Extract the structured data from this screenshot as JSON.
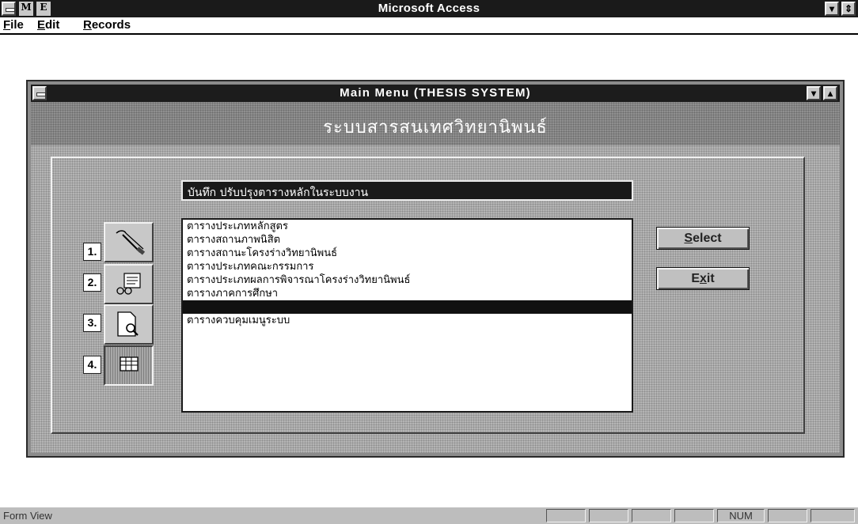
{
  "app": {
    "title": "Microsoft Access",
    "icon_m": "M",
    "icon_e": "E",
    "minimize_icon": "▾",
    "restore_icon": "⇕"
  },
  "menubar": {
    "items": [
      {
        "accel": "F",
        "rest": "ile"
      },
      {
        "accel": "E",
        "rest": "dit"
      },
      {
        "accel": "R",
        "rest": "ecords"
      }
    ]
  },
  "form": {
    "title": "Main  Menu  (THESIS  SYSTEM)",
    "minimize_icon": "▾",
    "maximize_icon": "▴",
    "heading": "ระบบสารสนเทศวิทยานิพนธ์",
    "caption": "บันทึก ปรับปรุงตารางหลักในระบบงาน",
    "list_items": [
      {
        "text": "ตารางประเภทหลักสูตร",
        "selected": false
      },
      {
        "text": "ตารางสถานภาพนิสิต",
        "selected": false
      },
      {
        "text": "ตารางสถานะโครงร่างวิทยานิพนธ์",
        "selected": false
      },
      {
        "text": "ตารางประเภทคณะกรรมการ",
        "selected": false
      },
      {
        "text": "ตารางประเภทผลการพิจารณาโครงร่างวิทยานิพนธ์",
        "selected": false
      },
      {
        "text": "ตารางภาคการศึกษา",
        "selected": false
      },
      {
        "text": "",
        "selected": true
      },
      {
        "text": "ตารางควบคุมเมนูระบบ",
        "selected": false
      }
    ],
    "nav_buttons": [
      {
        "number": "1.",
        "icon": "tools-icon",
        "pressed": false
      },
      {
        "number": "2.",
        "icon": "report-glasses-icon",
        "pressed": false
      },
      {
        "number": "3.",
        "icon": "document-magnifier-icon",
        "pressed": false
      },
      {
        "number": "4.",
        "icon": "table-grid-icon",
        "pressed": true
      }
    ],
    "select_button": {
      "accel": "S",
      "rest": "elect"
    },
    "exit_button": {
      "pre": "E",
      "accel": "x",
      "post": "it"
    }
  },
  "statusbar": {
    "text": "Form View",
    "indicator_num": "NUM"
  }
}
